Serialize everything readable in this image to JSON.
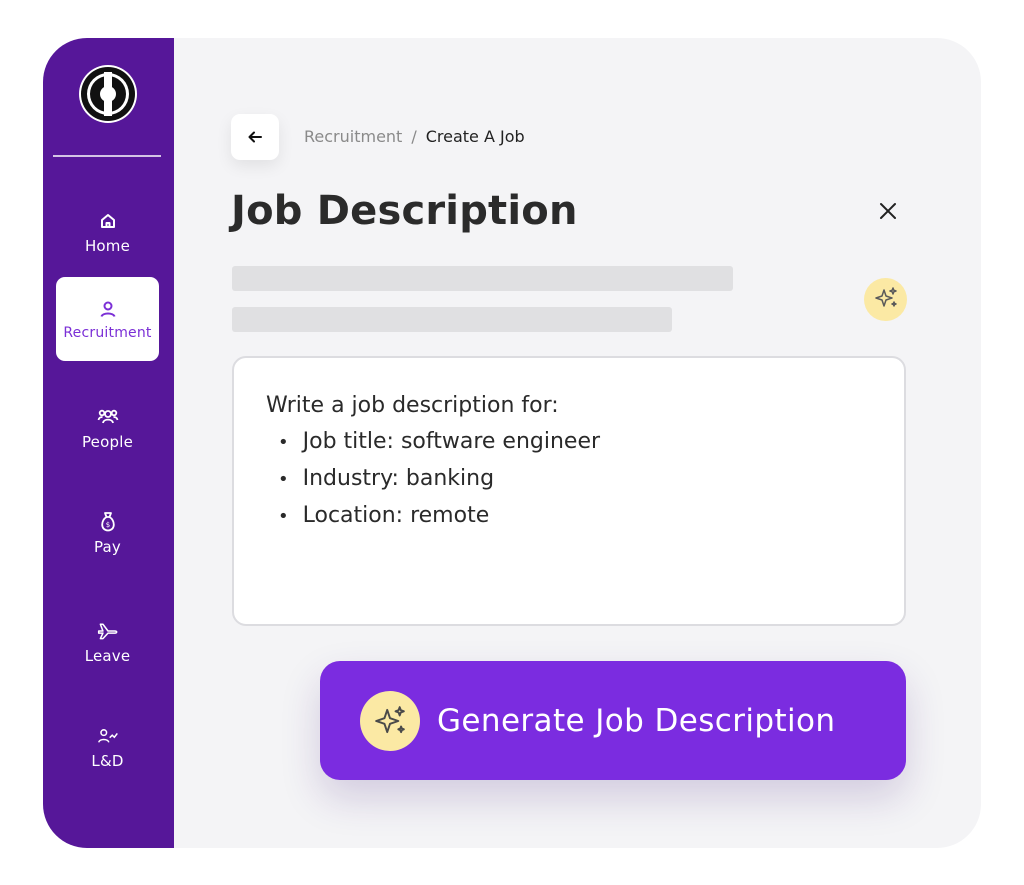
{
  "sidebar": {
    "logo": "brand-logo",
    "items": [
      {
        "label": "Home",
        "icon": "home-icon",
        "active": false
      },
      {
        "label": "Recruitment",
        "icon": "person-icon",
        "active": true
      },
      {
        "label": "People",
        "icon": "people-icon",
        "active": false
      },
      {
        "label": "Pay",
        "icon": "money-bag-icon",
        "active": false
      },
      {
        "label": "Leave",
        "icon": "airplane-icon",
        "active": false
      },
      {
        "label": "L&D",
        "icon": "learning-icon",
        "active": false
      }
    ]
  },
  "header": {
    "breadcrumb": {
      "parent": "Recruitment",
      "separator": "/",
      "current": "Create A Job"
    },
    "title": "Job Description"
  },
  "prompt": {
    "intro": "Write a job description for:",
    "items": [
      "Job title: software engineer",
      "Industry: banking",
      "Location: remote"
    ]
  },
  "generate_button": {
    "label": "Generate Job Description"
  },
  "colors": {
    "sidebar": "#561799",
    "accent": "#7b2ce0",
    "sparkle_bg": "#fbe9a4",
    "background": "#f4f4f6"
  }
}
